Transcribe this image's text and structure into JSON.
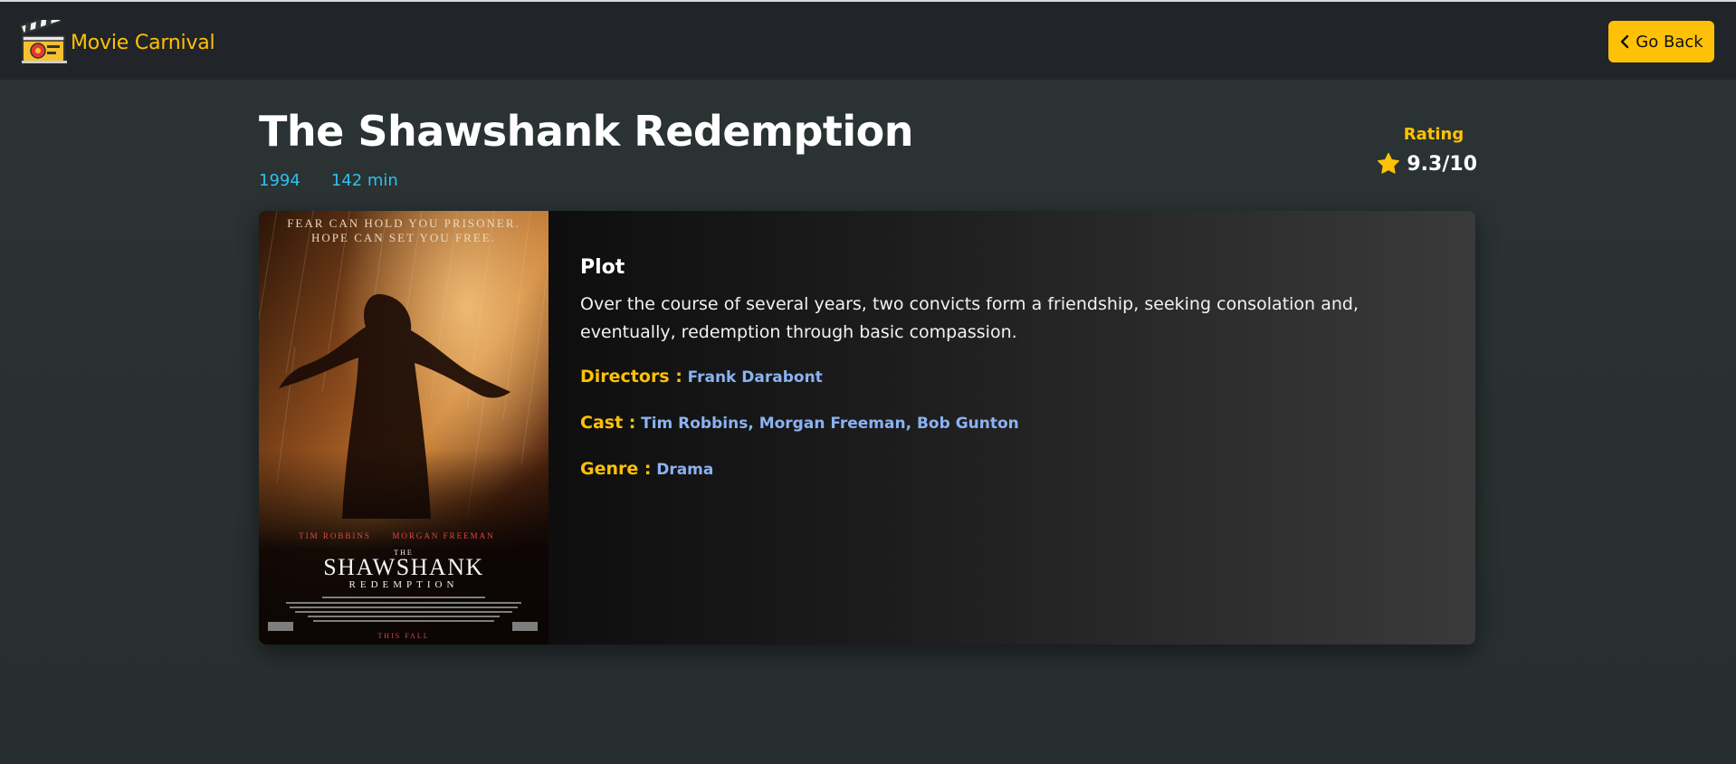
{
  "nav": {
    "brand_name": "Movie Carnival",
    "back_label": "Go Back"
  },
  "movie": {
    "title": "The Shawshank Redemption",
    "year": "1994",
    "runtime": "142 min",
    "rating_label": "Rating",
    "rating_value": "9.3/10",
    "plot_heading": "Plot",
    "plot": "Over the course of several years, two convicts form a friendship, seeking consolation and, eventually, redemption through basic compassion.",
    "directors_label": "Directors :",
    "directors": "Frank Darabont",
    "cast_label": "Cast :",
    "cast": "Tim Robbins, Morgan Freeman, Bob Gunton",
    "genre_label": "Genre :",
    "genre": "Drama"
  },
  "poster": {
    "tagline_1": "FEAR CAN HOLD YOU PRISONER.",
    "tagline_2": "HOPE CAN SET YOU FREE.",
    "actor_1": "TIM ROBBINS",
    "actor_2": "MORGAN FREEMAN",
    "title_the": "THE",
    "title_main": "SHAWSHANK",
    "title_sub": "REDEMPTION",
    "release": "THIS FALL"
  },
  "colors": {
    "accent": "#ffc107",
    "link": "#8bb2f2",
    "meta": "#2ec0ef",
    "navbar": "#212529",
    "background": "#283030"
  },
  "icons": {
    "brand": "clapperboard-icon",
    "back": "chevron-left-icon",
    "rating": "star-icon"
  }
}
